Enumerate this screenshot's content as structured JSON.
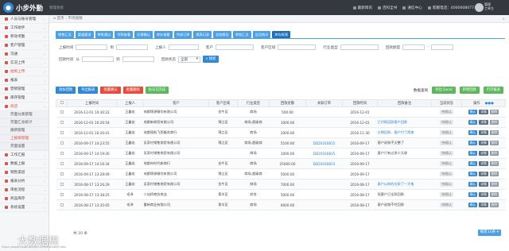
{
  "app": {
    "title": "小步外勤",
    "subtitle": "管理系统"
  },
  "topbar": {
    "links": [
      "最新简讯",
      "百科全书",
      "通信中心",
      "客服电话：4000608077"
    ],
    "user_line1": "管理",
    "user_line2": "工单主"
  },
  "sidebar": {
    "items": [
      {
        "label": "人员与账号管理",
        "icon": "people-icon"
      },
      {
        "label": "工作助手",
        "icon": "briefcase-icon"
      },
      {
        "label": "移动考勤",
        "icon": "clock-icon"
      },
      {
        "label": "客户管理",
        "icon": "customer-icon"
      },
      {
        "label": "沟通",
        "icon": "chat-icon"
      },
      {
        "label": "实况上传",
        "icon": "upload-icon"
      },
      {
        "label": "拍照上传",
        "icon": "camera-icon",
        "active": true
      },
      {
        "label": "报表",
        "icon": "report-icon"
      },
      {
        "label": "营销管理",
        "icon": "marketing-icon"
      },
      {
        "label": "库存管理",
        "icon": "warehouse-icon"
      },
      {
        "label": "商店",
        "icon": "shop-icon",
        "active": true
      }
    ],
    "subitems": [
      {
        "label": "页面分类管理"
      },
      {
        "label": "页面汇总统计"
      },
      {
        "label": "报销管理"
      },
      {
        "label": "上报单管理",
        "active": true
      },
      {
        "label": "页面设置"
      }
    ],
    "items_after": [
      {
        "label": "工作汇报",
        "icon": "report-icon"
      },
      {
        "label": "数据上报",
        "icon": "data-icon"
      },
      {
        "label": "销售渠道",
        "icon": "channel-icon"
      },
      {
        "label": "报表分析",
        "icon": "analysis-icon"
      },
      {
        "label": "审批流程",
        "icon": "flow-icon"
      },
      {
        "label": "商品库存",
        "icon": "goods-icon"
      },
      {
        "label": "系统设置",
        "icon": "gear-icon"
      }
    ]
  },
  "breadcrumb": {
    "home": "首页",
    "current": "市场观察"
  },
  "tabs": [
    "销售汇总",
    "渠道跟进",
    "审批通过",
    "付款查看",
    "反馈确认",
    "库存查看",
    "完成订单",
    "报表记录",
    "总结报告",
    "审批汇总",
    "会员统计",
    "库存报表"
  ],
  "active_tab": 11,
  "filters": {
    "row1": [
      {
        "label": "上报时间",
        "value": "从"
      },
      {
        "label": "到",
        "value": ""
      },
      {
        "label": "上报人",
        "value": ""
      },
      {
        "label": "客户",
        "value": ""
      },
      {
        "label": "客户区域",
        "value": ""
      },
      {
        "label": "行业类型",
        "value": ""
      },
      {
        "label": "回款额度",
        "value": ""
      }
    ],
    "row2_label": "回款时间",
    "row2_from": "从",
    "row2_to": "到",
    "state_label": "回款状态",
    "state_value": "全部",
    "search_button": "搜索"
  },
  "actions": {
    "buttons": [
      {
        "label": "添加回款",
        "color": "#2f89d8"
      },
      {
        "label": "导出报表",
        "color": "#2f89d8"
      },
      {
        "label": "批量确认",
        "color": "#e84c3d"
      },
      {
        "label": "批量删除",
        "color": "#e84c3d"
      },
      {
        "label": "标记已完成",
        "color": "#5cb85c"
      }
    ],
    "right_label": "数据查询",
    "right_buttons": [
      {
        "label": "导出 Excel",
        "color": "#5cb85c"
      },
      {
        "label": "新增回款",
        "color": "#5cb85c"
      },
      {
        "label": "打印报表",
        "color": "#5cb85c"
      }
    ]
  },
  "table": {
    "columns": [
      "",
      "上报时间",
      "上报人",
      "客户",
      "客户区域",
      "行业类型",
      "回款金额",
      "关联订单",
      "回款时间",
      "回款备注",
      "当前状态",
      "操作"
    ],
    "rows": [
      [
        "2016-12-01 10:30:22",
        "王鑫宏",
        "成都锦源餐饮有限公司",
        "金牛区",
        "商场",
        "500.00",
        "",
        "2016-12-01",
        "",
        "待确认"
      ],
      [
        "2016-12-01 10:26:54",
        "王鑫宏",
        "成都新商贸有限公司",
        "锦江区",
        "商场,超级商",
        "1000.00",
        "",
        "2016-12-01",
        "已付款回款客户回款",
        "待确认"
      ],
      [
        "2016-12-01 10:20:41",
        "王鑫宏",
        "成都银航飞鸽服务商行",
        "锦江区",
        "商场",
        "2000.00",
        "",
        "2016-11-30",
        "分期回款，客户付了两笔",
        "待确认"
      ],
      [
        "2016-09-17 14:23:55",
        "王鑫宏",
        "吴家村销售商贸有限公司",
        "锦江区",
        "商场,超级商",
        "5100.00",
        "DD20160815",
        "2016-09-17",
        "客户说账不太整了",
        "待确认"
      ],
      [
        "2016-09-17 14:19:26",
        "王鑫宏",
        "吴家村销售商贸有限公司",
        "",
        "商场",
        "1000.00",
        "DD20160815",
        "2016-09-17",
        "客户只有过多少天收",
        "待确认"
      ],
      [
        "2016-09-17 14:16:34",
        "王鑫宏",
        "成都市时代新商行",
        "金牛区",
        "商场",
        "25000.00",
        "DD20160815",
        "2016-09-17",
        "",
        "待确认"
      ],
      [
        "2016-09-17 13:28:09",
        "王鑫宏",
        "成都锦源餐饮有限公司",
        "锦江区",
        "商场,超级商",
        "5000.00",
        "",
        "2016-09-17",
        "",
        "待确认"
      ],
      [
        "2016-08-17 13:26:29",
        "王鑫宏",
        "吴家村销售商贸有限公司",
        "金牛区",
        "商场",
        "7000.00",
        "",
        "2016-08-17",
        "客户以前的欠款了一大笔",
        "待确认"
      ],
      [
        "2016-08-17 13:38:25",
        "毛泽",
        "二仙桥商务商业",
        "青羊区",
        "综合",
        "5000.00",
        "",
        "2016-08-17",
        "现客户已全款回款",
        "待确认"
      ],
      [
        "2016-08-17 13:35:05",
        "毛泽",
        "重新商业有限公司",
        "青羊区",
        "商场",
        "6000.00",
        "",
        "2016-08-17",
        "客户说账不付回款",
        "待确认"
      ]
    ],
    "row_buttons": [
      {
        "label": "确认",
        "color": "#2f89d8"
      },
      {
        "label": "详情",
        "color": "#5a6e82"
      },
      {
        "label": "删除",
        "color": "#8a96a3"
      }
    ]
  },
  "footer": {
    "total": "共 10 条",
    "pager": "每页10条"
  },
  "watermark": "大数据周",
  "footer_url": "https://www.xiaobuwaiqin.com/erp/pay/index"
}
